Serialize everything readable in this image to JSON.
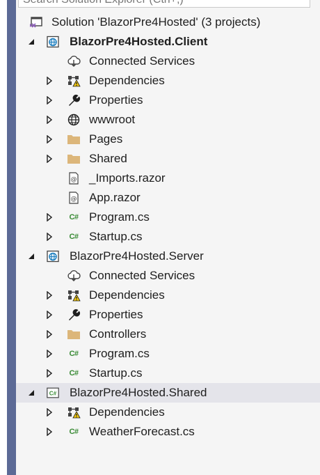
{
  "search": {
    "placeholder": "Search Solution Explorer (Ctrl+;)"
  },
  "solution": {
    "label": "Solution 'BlazorPre4Hosted' (3 projects)"
  },
  "client": {
    "label": "BlazorPre4Hosted.Client",
    "items": [
      {
        "label": "Connected Services",
        "icon": "connected-services-icon"
      },
      {
        "label": "Dependencies",
        "icon": "dependencies-warning-icon"
      },
      {
        "label": "Properties",
        "icon": "wrench-icon"
      },
      {
        "label": "wwwroot",
        "icon": "globe-icon"
      },
      {
        "label": "Pages",
        "icon": "folder-icon"
      },
      {
        "label": "Shared",
        "icon": "folder-icon"
      },
      {
        "label": "_Imports.razor",
        "icon": "razor-file-icon"
      },
      {
        "label": "App.razor",
        "icon": "razor-file-icon"
      },
      {
        "label": "Program.cs",
        "icon": "csharp-file-icon"
      },
      {
        "label": "Startup.cs",
        "icon": "csharp-file-icon"
      }
    ]
  },
  "server": {
    "label": "BlazorPre4Hosted.Server",
    "items": [
      {
        "label": "Connected Services",
        "icon": "connected-services-icon"
      },
      {
        "label": "Dependencies",
        "icon": "dependencies-warning-icon"
      },
      {
        "label": "Properties",
        "icon": "wrench-icon"
      },
      {
        "label": "Controllers",
        "icon": "folder-icon"
      },
      {
        "label": "Program.cs",
        "icon": "csharp-file-icon"
      },
      {
        "label": "Startup.cs",
        "icon": "csharp-file-icon"
      }
    ]
  },
  "shared": {
    "label": "BlazorPre4Hosted.Shared",
    "items": [
      {
        "label": "Dependencies",
        "icon": "dependencies-warning-icon"
      },
      {
        "label": "WeatherForecast.cs",
        "icon": "csharp-file-icon"
      }
    ]
  },
  "icons": {
    "csharp_glyph": "C#"
  },
  "colors": {
    "accent_bar": "#5c6a96",
    "folder": "#dcb67a",
    "csharp": "#388a34",
    "web_project": "#1e7fbf",
    "warning": "#f2c811",
    "selected_row": "#e4e4ea"
  }
}
